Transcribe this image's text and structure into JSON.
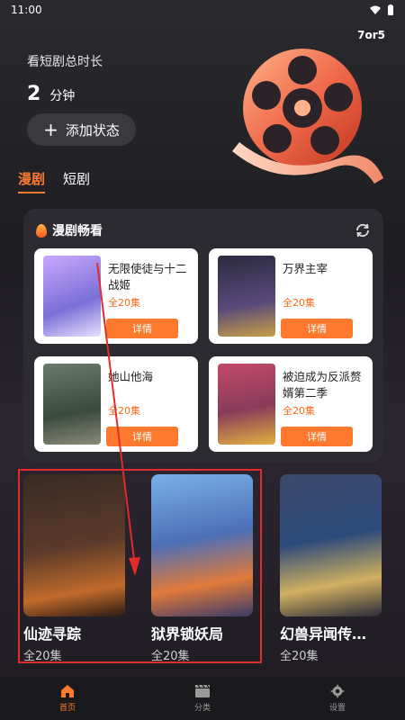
{
  "status_bar": {
    "time": "11:00"
  },
  "user_tag": "7or5",
  "header": {
    "label": "看短剧总时长",
    "duration_value": "2",
    "duration_unit": "分钟",
    "add_status": "添加状态"
  },
  "tabs": [
    {
      "label": "漫剧",
      "active": true
    },
    {
      "label": "短剧",
      "active": false
    }
  ],
  "panel": {
    "title": "漫剧畅看",
    "items": [
      {
        "title": "无限使徒与十二战姬",
        "count": "全20集",
        "button": "详情",
        "color": "#7b6fd6"
      },
      {
        "title": "万界主宰",
        "count": "全20集",
        "button": "详情",
        "color": "#3b3550"
      },
      {
        "title": "她山他海",
        "count": "全20集",
        "button": "详情",
        "color": "#4a5a4e"
      },
      {
        "title": "被迫成为反派赘婿第二季",
        "count": "全20集",
        "button": "详情",
        "color": "#8a3b5a"
      }
    ]
  },
  "posters": [
    {
      "title": "仙迹寻踪",
      "count": "全20集",
      "color": "#5a3a2a"
    },
    {
      "title": "狱界锁妖局",
      "count": "全20集",
      "color": "#4d6fb8"
    },
    {
      "title": "幻兽异闻传…",
      "count": "全20集",
      "color": "#2e4a7a"
    }
  ],
  "bottom_nav": [
    {
      "label": "首页",
      "icon": "home-icon",
      "active": true
    },
    {
      "label": "分类",
      "icon": "clapperboard-icon",
      "active": false
    },
    {
      "label": "设置",
      "icon": "gear-icon",
      "active": false
    }
  ],
  "colors": {
    "accent": "#ff7a2e",
    "highlight": "#e22b2b"
  }
}
